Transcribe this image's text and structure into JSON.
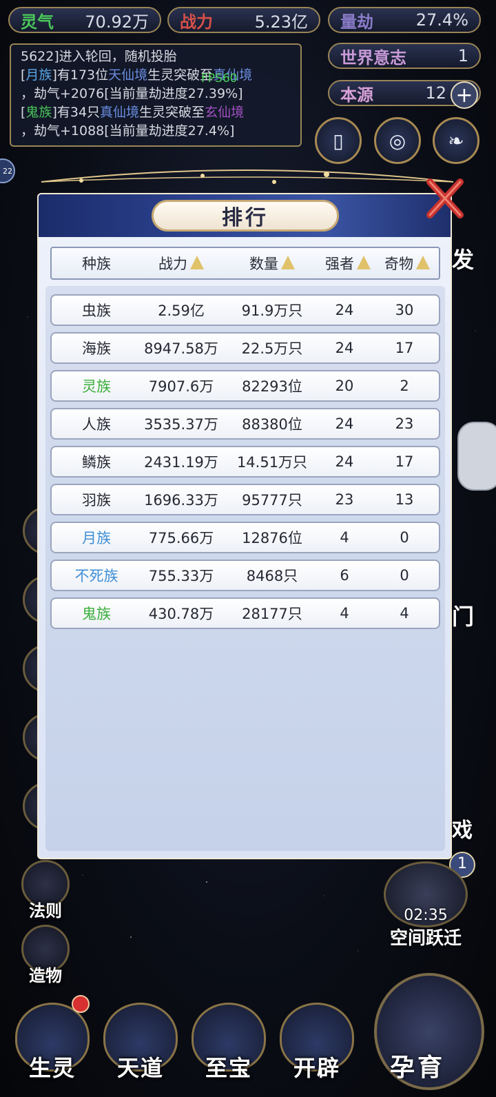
{
  "resources": {
    "lingqi": {
      "label": "灵气",
      "value": "70.92万",
      "color": "#4ac85a"
    },
    "zhanli": {
      "label": "战力",
      "value": "5.23亿",
      "color": "#d6504a"
    },
    "liangjie": {
      "label": "量劫",
      "value": "27.4%",
      "color": "#8a7cc8"
    },
    "shijie": {
      "label": "世界意志",
      "value": "1",
      "color": "#c89ad8"
    },
    "benyuan": {
      "label": "本源",
      "value": "12",
      "color": "#d8a0d8"
    }
  },
  "log": {
    "line1": "5622]进入轮回，随机投胎",
    "line2_a": "[",
    "line2_race": "月族",
    "line2_b": "]有173位",
    "line2_lv1": "天仙境",
    "line2_c": "生灵突破至",
    "line2_lv2": "真仙境",
    "line3": "，劫气+2076[当前量劫进度27.39%]",
    "line4_a": "[",
    "line4_race": "鬼族",
    "line4_b": "]有34只",
    "line4_lv1": "真仙境",
    "line4_c": "生灵突破至",
    "line4_lv2": "玄仙境",
    "line5": "，劫气+1088[当前量劫进度27.4%]"
  },
  "fps": "FPS60",
  "modal": {
    "title": "排行",
    "columns": [
      {
        "label": "种族",
        "sortable": false
      },
      {
        "label": "战力",
        "sortable": true
      },
      {
        "label": "数量",
        "sortable": true
      },
      {
        "label": "强者",
        "sortable": true
      },
      {
        "label": "奇物",
        "sortable": true
      }
    ],
    "rows": [
      {
        "race": "虫族",
        "power": "2.59亿",
        "count": "91.9万只",
        "strong": "24",
        "treasure": "30",
        "color": "default"
      },
      {
        "race": "海族",
        "power": "8947.58万",
        "count": "22.5万只",
        "strong": "24",
        "treasure": "17",
        "color": "default"
      },
      {
        "race": "灵族",
        "power": "7907.6万",
        "count": "82293位",
        "strong": "20",
        "treasure": "2",
        "color": "green"
      },
      {
        "race": "人族",
        "power": "3535.37万",
        "count": "88380位",
        "strong": "24",
        "treasure": "23",
        "color": "default"
      },
      {
        "race": "鳞族",
        "power": "2431.19万",
        "count": "14.51万只",
        "strong": "24",
        "treasure": "17",
        "color": "default"
      },
      {
        "race": "羽族",
        "power": "1696.33万",
        "count": "95777只",
        "strong": "23",
        "treasure": "13",
        "color": "default"
      },
      {
        "race": "月族",
        "power": "775.66万",
        "count": "12876位",
        "strong": "4",
        "treasure": "0",
        "color": "blue"
      },
      {
        "race": "不死族",
        "power": "755.33万",
        "count": "8468只",
        "strong": "6",
        "treasure": "0",
        "color": "blue"
      },
      {
        "race": "鬼族",
        "power": "430.78万",
        "count": "28177只",
        "strong": "4",
        "treasure": "4",
        "color": "green"
      }
    ]
  },
  "side_menu": {
    "fa_ze": "法则",
    "zao_wu": "造物"
  },
  "space_jump": {
    "timer": "02:35",
    "label": "空间跃迁",
    "badge": "1"
  },
  "bottom_nav": {
    "sheng_ling": "生灵",
    "tian_dao": "天道",
    "zhi_bao": "至宝",
    "kai_pi": "开辟",
    "yun_yu": "孕育"
  },
  "partial_labels": {
    "right1": "发",
    "right2": "门",
    "right3": "戏",
    "left_avatar": "22"
  }
}
